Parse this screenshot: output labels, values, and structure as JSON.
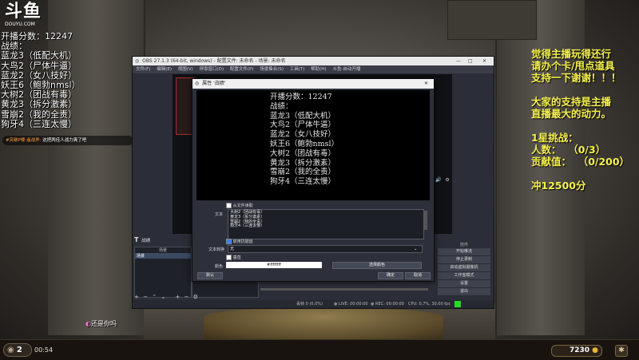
{
  "logo": {
    "main": "斗鱼",
    "sub": "DOUYU.COM"
  },
  "overlay_left": {
    "lines": [
      "开播分数：12247",
      "战绩：",
      "蓝龙3（低配大机）",
      "大鸟2（尸体牛逼）",
      "蓝龙2（女八技好）",
      "妖王6（鲍勃nmsl）",
      "大树2（团战有毒）",
      "黄龙3（拆分激素）",
      "雪崩2（我的全责）",
      "狗牙4（三连太慢）"
    ]
  },
  "danmaku": {
    "user": "#突破P楼·遥战斧:",
    "text": "这把两佳人战力爽了吧"
  },
  "overlay_right": {
    "lines": [
      "觉得主播玩得还行",
      "请办个卡/甩点道具",
      "支持一下谢谢！！！",
      "",
      "大家的支持是主播",
      "直播最大的动力。",
      "",
      "1星挑战：",
      "人数：  （0/3）",
      "贡献值：  （0/200）",
      "",
      "冲12500分"
    ]
  },
  "chat_bubble": "还是你吗",
  "bottom": {
    "level": "2",
    "timer": "00:54",
    "gold": "7230"
  },
  "obs": {
    "title": "OBS 27.1.3 (64-bit, windows) - 配置文件: 未命名 - 场景: 未命名",
    "menu": [
      "文件(F)",
      "编辑(E)",
      "视图(V)",
      "停靠窗口(D)",
      "配置文件(P)",
      "场景集合(S)",
      "工具(T)",
      "帮助(H)",
      "斗鱼-自动开播"
    ],
    "scenes_label": "场景",
    "scene_item": "场景",
    "sources_label": "来源",
    "controls_label": "控件",
    "controls": [
      "开始推流",
      "停止录制",
      "启动虚拟摄像机",
      "工作室模式",
      "设置",
      "退出"
    ],
    "status": [
      "丢帧 0 (0.0%)",
      "LIVE: 00:00:00",
      "REC: 00:00:00",
      "CPU: 0.7%, 30.00 fps"
    ]
  },
  "dialog": {
    "title": "属性 '战绩'",
    "preview_lines": [
      "开播分数：12247",
      "战绩：",
      "蓝龙3（低配大机）",
      "大鸟2（尸体牛逼）",
      "蓝龙2（女八技好）",
      "妖王6（鲍勃nmsl）",
      "大树2（团战有毒）",
      "黄龙3（拆分激素）",
      "雪崩2（我的全责）",
      "狗牙4（三连太慢）"
    ],
    "from_file_label": "从文件读取",
    "text_label": "文本",
    "text_value_lines": [
      "大树2（团战有毒）",
      "黄龙3（拆分激素）",
      "雪崩2（我的全责）",
      "狗牙4（三连太慢）"
    ],
    "antialias_label": "启用抗锯齿",
    "transform_label": "文本转换",
    "transform_value": "无",
    "vertical_label": "垂直",
    "color_label": "颜色",
    "color_value": "#ffffffff",
    "color_button": "选择颜色",
    "defaults_button": "默认",
    "ok_button": "确定",
    "cancel_button": "取消"
  },
  "colors": {
    "overlay_yellow": "#f7f34c",
    "live_green": "#22dd22"
  }
}
